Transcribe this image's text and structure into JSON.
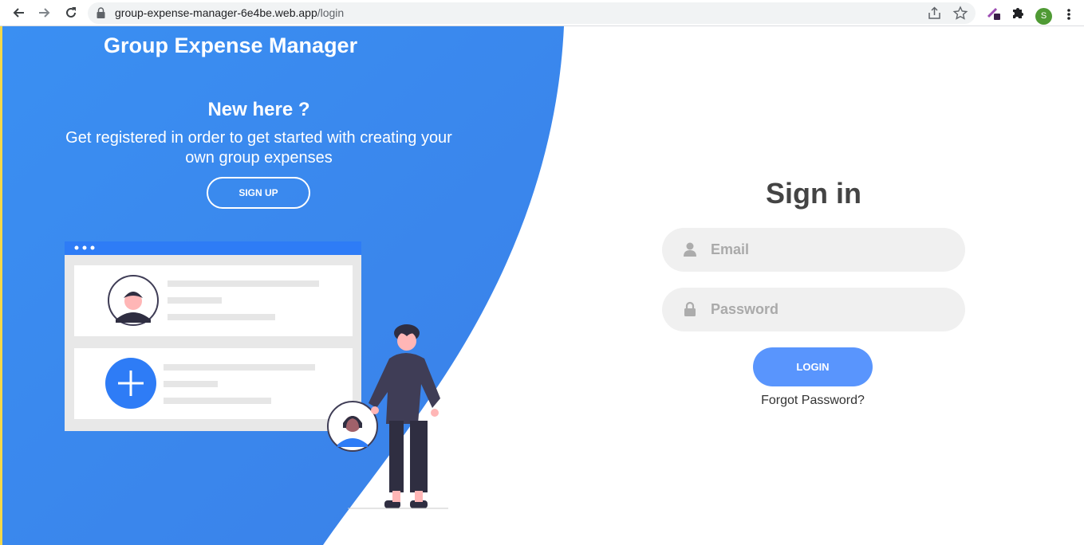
{
  "browser": {
    "url_host": "group-expense-manager-6e4be.web.app",
    "url_path": "/login",
    "profile_initial": "S",
    "icons": {
      "back": "back-arrow-icon",
      "forward": "forward-arrow-icon",
      "reload": "reload-icon",
      "lock": "lock-icon",
      "share": "share-icon",
      "bookmark": "star-icon",
      "extension_1": "eyedropper-extension-icon",
      "extensions": "puzzle-icon",
      "menu": "kebab-menu-icon"
    }
  },
  "left_panel": {
    "app_title": "Group Expense Manager",
    "heading": "New here ?",
    "description": "Get registered in order to get started with creating your own group expenses",
    "signup_label": "SIGN UP",
    "accent_color": "#3a8ff2"
  },
  "signin": {
    "title": "Sign in",
    "email_placeholder": "Email",
    "password_placeholder": "Password",
    "login_label": "LOGIN",
    "forgot_label": "Forgot Password?",
    "button_color": "#5995fd",
    "icons": {
      "email": "user-icon",
      "password": "lock-icon"
    }
  }
}
